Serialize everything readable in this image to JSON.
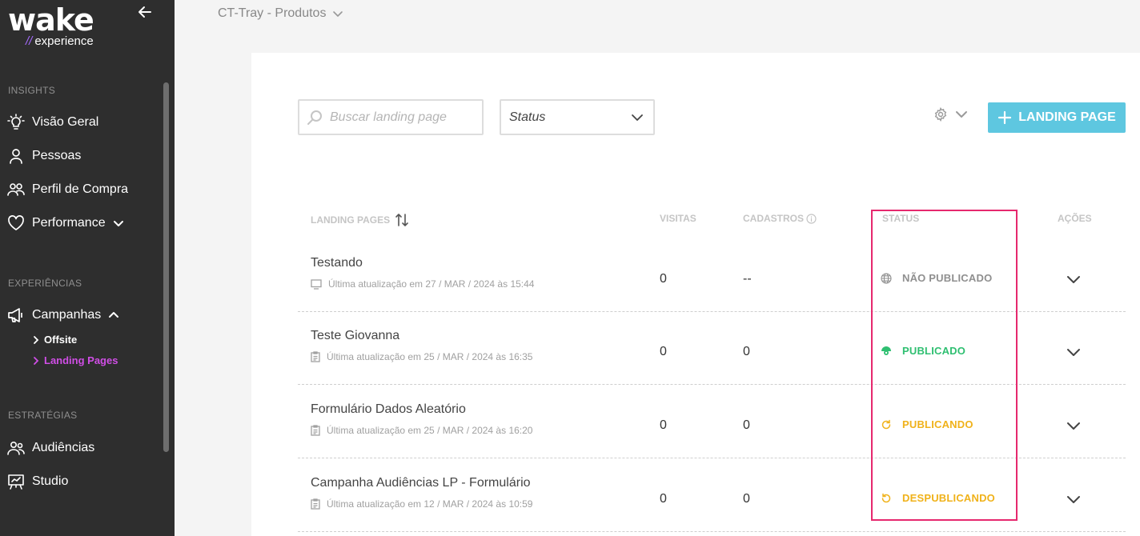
{
  "brand": {
    "logo_text": "wake",
    "logo_sub_slashes": "//",
    "logo_sub": "experience"
  },
  "sidebar": {
    "sections": [
      {
        "title": "INSIGHTS",
        "items": [
          {
            "label": "Visão Geral",
            "icon": "lightbulb-icon"
          },
          {
            "label": "Pessoas",
            "icon": "person-icon"
          },
          {
            "label": "Perfil de Compra",
            "icon": "people-icon"
          },
          {
            "label": "Performance",
            "icon": "heart-icon",
            "expandable": true
          }
        ]
      },
      {
        "title": "EXPERIÊNCIAS",
        "items": [
          {
            "label": "Campanhas",
            "icon": "megaphone-icon",
            "expanded": true,
            "children": [
              {
                "label": "Offsite"
              },
              {
                "label": "Landing Pages",
                "active": true
              }
            ]
          }
        ]
      },
      {
        "title": "ESTRATÉGIAS",
        "items": [
          {
            "label": "Audiências",
            "icon": "audience-icon"
          },
          {
            "label": "Studio",
            "icon": "presentation-icon"
          }
        ]
      }
    ]
  },
  "header": {
    "breadcrumb": "CT-Tray - Produtos"
  },
  "toolbar": {
    "search_placeholder": "Buscar landing page",
    "status_filter": "Status",
    "add_button": "LANDING PAGE"
  },
  "table": {
    "columns": {
      "name": "LANDING PAGES",
      "visits": "VISITAS",
      "signups": "CADASTROS",
      "status": "STATUS",
      "actions": "AÇÕES"
    },
    "rows": [
      {
        "name": "Testando",
        "updated": "Última atualização em 27 / MAR / 2024 às 15:44",
        "visits": "0",
        "signups": "--",
        "status": "NÃO PUBLICADO",
        "status_color": "#8f8f8f",
        "status_icon": "globe-icon",
        "meta_icon": "monitor-icon"
      },
      {
        "name": "Teste Giovanna",
        "updated": "Última atualização em 25 / MAR / 2024 às 16:35",
        "visits": "0",
        "signups": "0",
        "status": "PUBLICADO",
        "status_color": "#2fbf71",
        "status_icon": "published-globe-icon",
        "meta_icon": "form-icon"
      },
      {
        "name": "Formulário Dados Aleatório",
        "updated": "Última atualização em 25 / MAR / 2024 às 16:20",
        "visits": "0",
        "signups": "0",
        "status": "PUBLICANDO",
        "status_color": "#f0b21a",
        "status_icon": "refresh-icon",
        "meta_icon": "form-icon"
      },
      {
        "name": "Campanha Audiências LP - Formulário",
        "updated": "Última atualização em 12 / MAR / 2024 às 10:59",
        "visits": "0",
        "signups": "0",
        "status": "DESPUBLICANDO",
        "status_color": "#f0b21a",
        "status_icon": "undo-icon",
        "meta_icon": "form-icon"
      }
    ]
  },
  "colors": {
    "sidebar_bg": "#2e2e2e",
    "accent_purple": "#d04ee6",
    "button_blue": "#5ec7e0",
    "highlight": "#e6286e"
  }
}
